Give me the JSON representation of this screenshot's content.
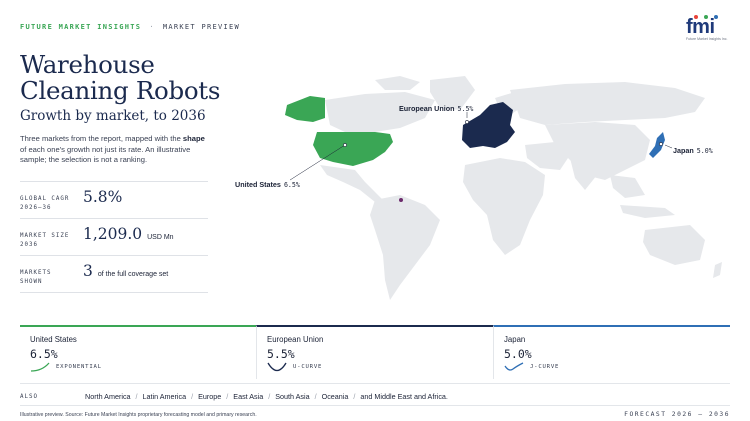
{
  "header": {
    "brand": "FUTURE MARKET INSIGHTS",
    "separator": "·",
    "section": "MARKET PREVIEW",
    "logo_text": "fmi",
    "logo_subtext": "Future Market Insights Inc.",
    "logo_dot_colors": [
      "#e8443a",
      "#3aa655",
      "#2f6fb5"
    ]
  },
  "title_block": {
    "title": "Warehouse Cleaning Robots",
    "subtitle": "Growth by market, to 2036",
    "desc_pre": "Three markets from the report, mapped with the ",
    "desc_bold": "shape",
    "desc_post": " of each one's growth not just its rate. An illustrative sample; the selection is not a ranking."
  },
  "stats": [
    {
      "label_line1": "GLOBAL CAGR",
      "label_line2": "2026–36",
      "value": "5.8%",
      "unit": ""
    },
    {
      "label_line1": "MARKET SIZE",
      "label_line2": "2036",
      "value": "1,209.0",
      "unit": "USD Mn"
    },
    {
      "label_line1": "MARKETS",
      "label_line2": "SHOWN",
      "value": "3",
      "unit": "of the full coverage set"
    }
  ],
  "map": {
    "labels": [
      {
        "name": "European Union",
        "pct": "5.5%"
      },
      {
        "name": "United States",
        "pct": "6.5%"
      },
      {
        "name": "Japan",
        "pct": "5.0%"
      }
    ],
    "colors": {
      "land": "#e6e8eb",
      "us": "#3aa655",
      "eu": "#1b2a4e",
      "jp": "#2f6fb5",
      "marker": "#6b2a6b"
    }
  },
  "cards": [
    {
      "name": "United States",
      "value": "6.5%",
      "shape": "EXPONENTIAL"
    },
    {
      "name": "European Union",
      "value": "5.5%",
      "shape": "U-CURVE"
    },
    {
      "name": "Japan",
      "value": "5.0%",
      "shape": "J-CURVE"
    }
  ],
  "also": {
    "label": "ALSO",
    "regions": [
      "North America",
      "Latin America",
      "Europe",
      "East Asia",
      "South Asia",
      "Oceania",
      "and Middle East and Africa."
    ]
  },
  "footer": {
    "source": "Illustrative preview. Source: Future Market Insights proprietary forecasting model and primary research.",
    "forecast": "FORECAST 2026 – 2036"
  }
}
